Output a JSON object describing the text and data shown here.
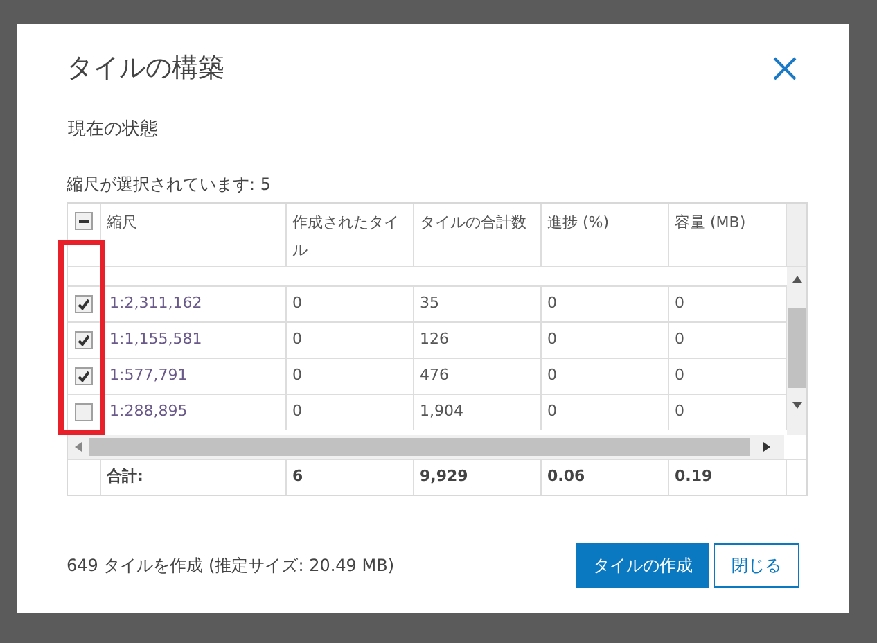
{
  "dialog": {
    "title": "タイルの構築",
    "status_label": "現在の状態",
    "selection_text": "縮尺が選択されています: 5"
  },
  "table": {
    "select_all": {
      "indeterminate": true
    },
    "columns": [
      "縮尺",
      "作成されたタイル",
      "タイルの合計数",
      "進捗 (%)",
      "容量 (MB)"
    ],
    "rows": [
      {
        "checked": true,
        "cells": [
          "1:2,311,162",
          "0",
          "35",
          "0",
          "0"
        ]
      },
      {
        "checked": true,
        "cells": [
          "1:1,155,581",
          "0",
          "126",
          "0",
          "0"
        ]
      },
      {
        "checked": true,
        "cells": [
          "1:577,791",
          "0",
          "476",
          "0",
          "0"
        ]
      },
      {
        "checked": false,
        "cells": [
          "1:288,895",
          "0",
          "1,904",
          "0",
          "0"
        ]
      }
    ],
    "totals": [
      "合計:",
      "6",
      "9,929",
      "0.06",
      "0.19"
    ]
  },
  "summary": "649 タイルを作成 (推定サイズ: 20.49 MB)",
  "buttons": [
    {
      "label": "タイルの作成",
      "kind": "primary"
    },
    {
      "label": "閉じる",
      "kind": "secondary"
    }
  ]
}
